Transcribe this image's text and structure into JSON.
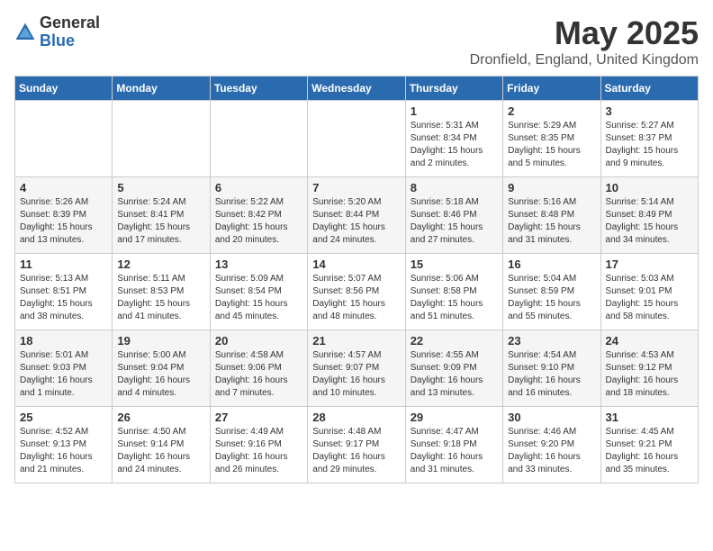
{
  "logo": {
    "general": "General",
    "blue": "Blue"
  },
  "title": "May 2025",
  "location": "Dronfield, England, United Kingdom",
  "weekdays": [
    "Sunday",
    "Monday",
    "Tuesday",
    "Wednesday",
    "Thursday",
    "Friday",
    "Saturday"
  ],
  "weeks": [
    [
      {
        "day": "",
        "sunrise": "",
        "sunset": "",
        "daylight": ""
      },
      {
        "day": "",
        "sunrise": "",
        "sunset": "",
        "daylight": ""
      },
      {
        "day": "",
        "sunrise": "",
        "sunset": "",
        "daylight": ""
      },
      {
        "day": "",
        "sunrise": "",
        "sunset": "",
        "daylight": ""
      },
      {
        "day": "1",
        "sunrise": "Sunrise: 5:31 AM",
        "sunset": "Sunset: 8:34 PM",
        "daylight": "Daylight: 15 hours and 2 minutes."
      },
      {
        "day": "2",
        "sunrise": "Sunrise: 5:29 AM",
        "sunset": "Sunset: 8:35 PM",
        "daylight": "Daylight: 15 hours and 5 minutes."
      },
      {
        "day": "3",
        "sunrise": "Sunrise: 5:27 AM",
        "sunset": "Sunset: 8:37 PM",
        "daylight": "Daylight: 15 hours and 9 minutes."
      }
    ],
    [
      {
        "day": "4",
        "sunrise": "Sunrise: 5:26 AM",
        "sunset": "Sunset: 8:39 PM",
        "daylight": "Daylight: 15 hours and 13 minutes."
      },
      {
        "day": "5",
        "sunrise": "Sunrise: 5:24 AM",
        "sunset": "Sunset: 8:41 PM",
        "daylight": "Daylight: 15 hours and 17 minutes."
      },
      {
        "day": "6",
        "sunrise": "Sunrise: 5:22 AM",
        "sunset": "Sunset: 8:42 PM",
        "daylight": "Daylight: 15 hours and 20 minutes."
      },
      {
        "day": "7",
        "sunrise": "Sunrise: 5:20 AM",
        "sunset": "Sunset: 8:44 PM",
        "daylight": "Daylight: 15 hours and 24 minutes."
      },
      {
        "day": "8",
        "sunrise": "Sunrise: 5:18 AM",
        "sunset": "Sunset: 8:46 PM",
        "daylight": "Daylight: 15 hours and 27 minutes."
      },
      {
        "day": "9",
        "sunrise": "Sunrise: 5:16 AM",
        "sunset": "Sunset: 8:48 PM",
        "daylight": "Daylight: 15 hours and 31 minutes."
      },
      {
        "day": "10",
        "sunrise": "Sunrise: 5:14 AM",
        "sunset": "Sunset: 8:49 PM",
        "daylight": "Daylight: 15 hours and 34 minutes."
      }
    ],
    [
      {
        "day": "11",
        "sunrise": "Sunrise: 5:13 AM",
        "sunset": "Sunset: 8:51 PM",
        "daylight": "Daylight: 15 hours and 38 minutes."
      },
      {
        "day": "12",
        "sunrise": "Sunrise: 5:11 AM",
        "sunset": "Sunset: 8:53 PM",
        "daylight": "Daylight: 15 hours and 41 minutes."
      },
      {
        "day": "13",
        "sunrise": "Sunrise: 5:09 AM",
        "sunset": "Sunset: 8:54 PM",
        "daylight": "Daylight: 15 hours and 45 minutes."
      },
      {
        "day": "14",
        "sunrise": "Sunrise: 5:07 AM",
        "sunset": "Sunset: 8:56 PM",
        "daylight": "Daylight: 15 hours and 48 minutes."
      },
      {
        "day": "15",
        "sunrise": "Sunrise: 5:06 AM",
        "sunset": "Sunset: 8:58 PM",
        "daylight": "Daylight: 15 hours and 51 minutes."
      },
      {
        "day": "16",
        "sunrise": "Sunrise: 5:04 AM",
        "sunset": "Sunset: 8:59 PM",
        "daylight": "Daylight: 15 hours and 55 minutes."
      },
      {
        "day": "17",
        "sunrise": "Sunrise: 5:03 AM",
        "sunset": "Sunset: 9:01 PM",
        "daylight": "Daylight: 15 hours and 58 minutes."
      }
    ],
    [
      {
        "day": "18",
        "sunrise": "Sunrise: 5:01 AM",
        "sunset": "Sunset: 9:03 PM",
        "daylight": "Daylight: 16 hours and 1 minute."
      },
      {
        "day": "19",
        "sunrise": "Sunrise: 5:00 AM",
        "sunset": "Sunset: 9:04 PM",
        "daylight": "Daylight: 16 hours and 4 minutes."
      },
      {
        "day": "20",
        "sunrise": "Sunrise: 4:58 AM",
        "sunset": "Sunset: 9:06 PM",
        "daylight": "Daylight: 16 hours and 7 minutes."
      },
      {
        "day": "21",
        "sunrise": "Sunrise: 4:57 AM",
        "sunset": "Sunset: 9:07 PM",
        "daylight": "Daylight: 16 hours and 10 minutes."
      },
      {
        "day": "22",
        "sunrise": "Sunrise: 4:55 AM",
        "sunset": "Sunset: 9:09 PM",
        "daylight": "Daylight: 16 hours and 13 minutes."
      },
      {
        "day": "23",
        "sunrise": "Sunrise: 4:54 AM",
        "sunset": "Sunset: 9:10 PM",
        "daylight": "Daylight: 16 hours and 16 minutes."
      },
      {
        "day": "24",
        "sunrise": "Sunrise: 4:53 AM",
        "sunset": "Sunset: 9:12 PM",
        "daylight": "Daylight: 16 hours and 18 minutes."
      }
    ],
    [
      {
        "day": "25",
        "sunrise": "Sunrise: 4:52 AM",
        "sunset": "Sunset: 9:13 PM",
        "daylight": "Daylight: 16 hours and 21 minutes."
      },
      {
        "day": "26",
        "sunrise": "Sunrise: 4:50 AM",
        "sunset": "Sunset: 9:14 PM",
        "daylight": "Daylight: 16 hours and 24 minutes."
      },
      {
        "day": "27",
        "sunrise": "Sunrise: 4:49 AM",
        "sunset": "Sunset: 9:16 PM",
        "daylight": "Daylight: 16 hours and 26 minutes."
      },
      {
        "day": "28",
        "sunrise": "Sunrise: 4:48 AM",
        "sunset": "Sunset: 9:17 PM",
        "daylight": "Daylight: 16 hours and 29 minutes."
      },
      {
        "day": "29",
        "sunrise": "Sunrise: 4:47 AM",
        "sunset": "Sunset: 9:18 PM",
        "daylight": "Daylight: 16 hours and 31 minutes."
      },
      {
        "day": "30",
        "sunrise": "Sunrise: 4:46 AM",
        "sunset": "Sunset: 9:20 PM",
        "daylight": "Daylight: 16 hours and 33 minutes."
      },
      {
        "day": "31",
        "sunrise": "Sunrise: 4:45 AM",
        "sunset": "Sunset: 9:21 PM",
        "daylight": "Daylight: 16 hours and 35 minutes."
      }
    ]
  ]
}
